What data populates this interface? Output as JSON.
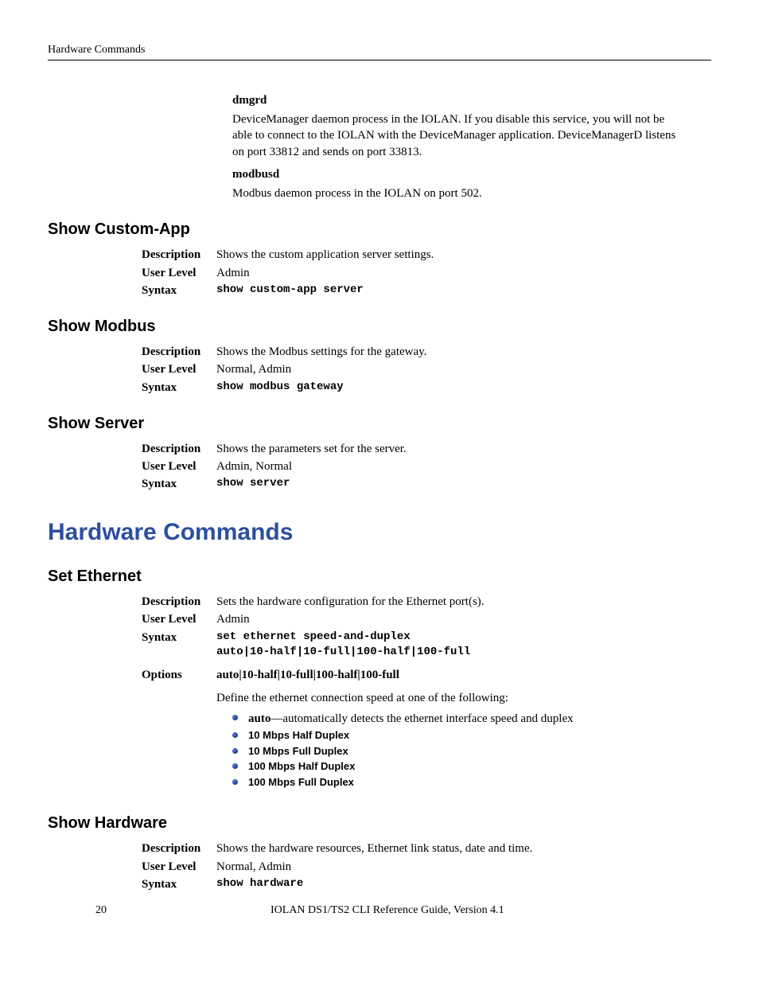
{
  "header": {
    "running": "Hardware Commands"
  },
  "intro": {
    "dmgrd": {
      "title": "dmgrd",
      "text": "DeviceManager daemon process in the IOLAN. If you disable this service, you will not be able to connect to the IOLAN with the DeviceManager application. DeviceManagerD listens on port 33812 and sends on port 33813."
    },
    "modbusd": {
      "title": "modbusd",
      "text": "Modbus daemon process in the IOLAN on port 502."
    }
  },
  "showCustomApp": {
    "heading": "Show Custom-App",
    "descLabel": "Description",
    "descValue": "Shows the custom application server settings.",
    "userLabel": "User Level",
    "userValue": "Admin",
    "syntaxLabel": "Syntax",
    "syntaxValue": "show custom-app server"
  },
  "showModbus": {
    "heading": "Show Modbus",
    "descLabel": "Description",
    "descValue": "Shows the Modbus settings for the gateway.",
    "userLabel": "User Level",
    "userValue": "Normal, Admin",
    "syntaxLabel": "Syntax",
    "syntaxValue": "show modbus gateway"
  },
  "showServer": {
    "heading": "Show Server",
    "descLabel": "Description",
    "descValue": "Shows the parameters set for the server.",
    "userLabel": "User Level",
    "userValue": "Admin, Normal",
    "syntaxLabel": "Syntax",
    "syntaxValue": "show server"
  },
  "hardwareCommands": {
    "title": "Hardware Commands"
  },
  "setEthernet": {
    "heading": "Set Ethernet",
    "descLabel": "Description",
    "descValue": "Sets the hardware configuration for the Ethernet port(s).",
    "userLabel": "User Level",
    "userValue": "Admin",
    "syntaxLabel": "Syntax",
    "syntaxValue": "set ethernet speed-and-duplex\nauto|10-half|10-full|100-half|100-full",
    "optionsLabel": "Options",
    "optionsHeader": "auto|10-half|10-full|100-half|100-full",
    "optionsIntro": "Define the ethernet connection speed at one of the following:",
    "bullets": {
      "b0_term": "auto",
      "b0_rest": "—automatically detects the ethernet interface speed and duplex",
      "b1": "10 Mbps Half Duplex",
      "b2": "10 Mbps Full Duplex",
      "b3": "100 Mbps Half Duplex",
      "b4": "100 Mbps Full Duplex"
    }
  },
  "showHardware": {
    "heading": "Show Hardware",
    "descLabel": "Description",
    "descValue": "Shows the hardware resources, Ethernet link status, date and time.",
    "userLabel": "User Level",
    "userValue": "Normal, Admin",
    "syntaxLabel": "Syntax",
    "syntaxValue": "show hardware"
  },
  "footer": {
    "page": "20",
    "guide": "IOLAN DS1/TS2 CLI Reference Guide, Version 4.1"
  }
}
